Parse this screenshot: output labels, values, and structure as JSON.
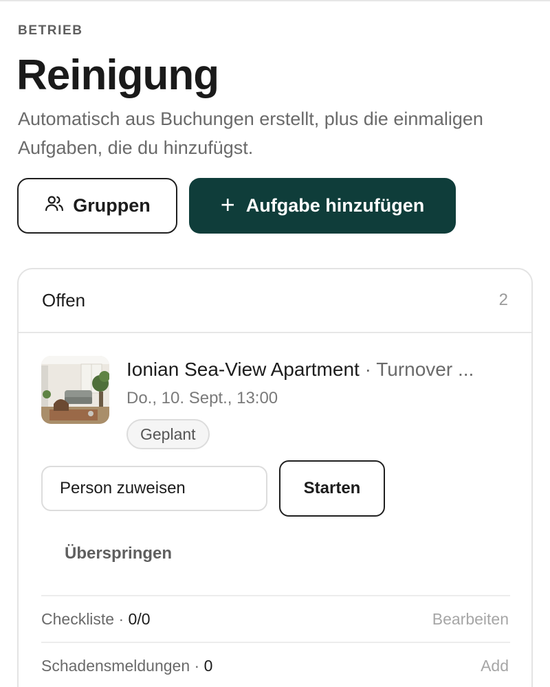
{
  "header": {
    "eyebrow": "BETRIEB",
    "title": "Reinigung",
    "subtitle": "Automatisch aus Buchungen erstellt, plus die einmaligen Aufgaben, die du hinzufügst."
  },
  "actions": {
    "groups_label": "Gruppen",
    "groups_icon": "users-icon",
    "add_task_label": "Aufgabe hinzufügen",
    "add_task_icon": "plus-icon",
    "accent_color": "#0f3d3a"
  },
  "open_section": {
    "title": "Offen",
    "count": "2",
    "tasks": [
      {
        "property_name": "Ionian Sea-View Apartment",
        "separator": " · ",
        "task_type": "Turnover ...",
        "datetime": "Do., 10. Sept., 13:00",
        "status": "Geplant",
        "assign_placeholder": "Person zuweisen",
        "start_label": "Starten",
        "skip_label": "Überspringen",
        "checklist_label": "Checkliste · ",
        "checklist_value": "0/0",
        "checklist_action": "Bearbeiten",
        "damage_label": "Schadensmeldungen · ",
        "damage_value": "0",
        "damage_action": "Add"
      }
    ]
  }
}
